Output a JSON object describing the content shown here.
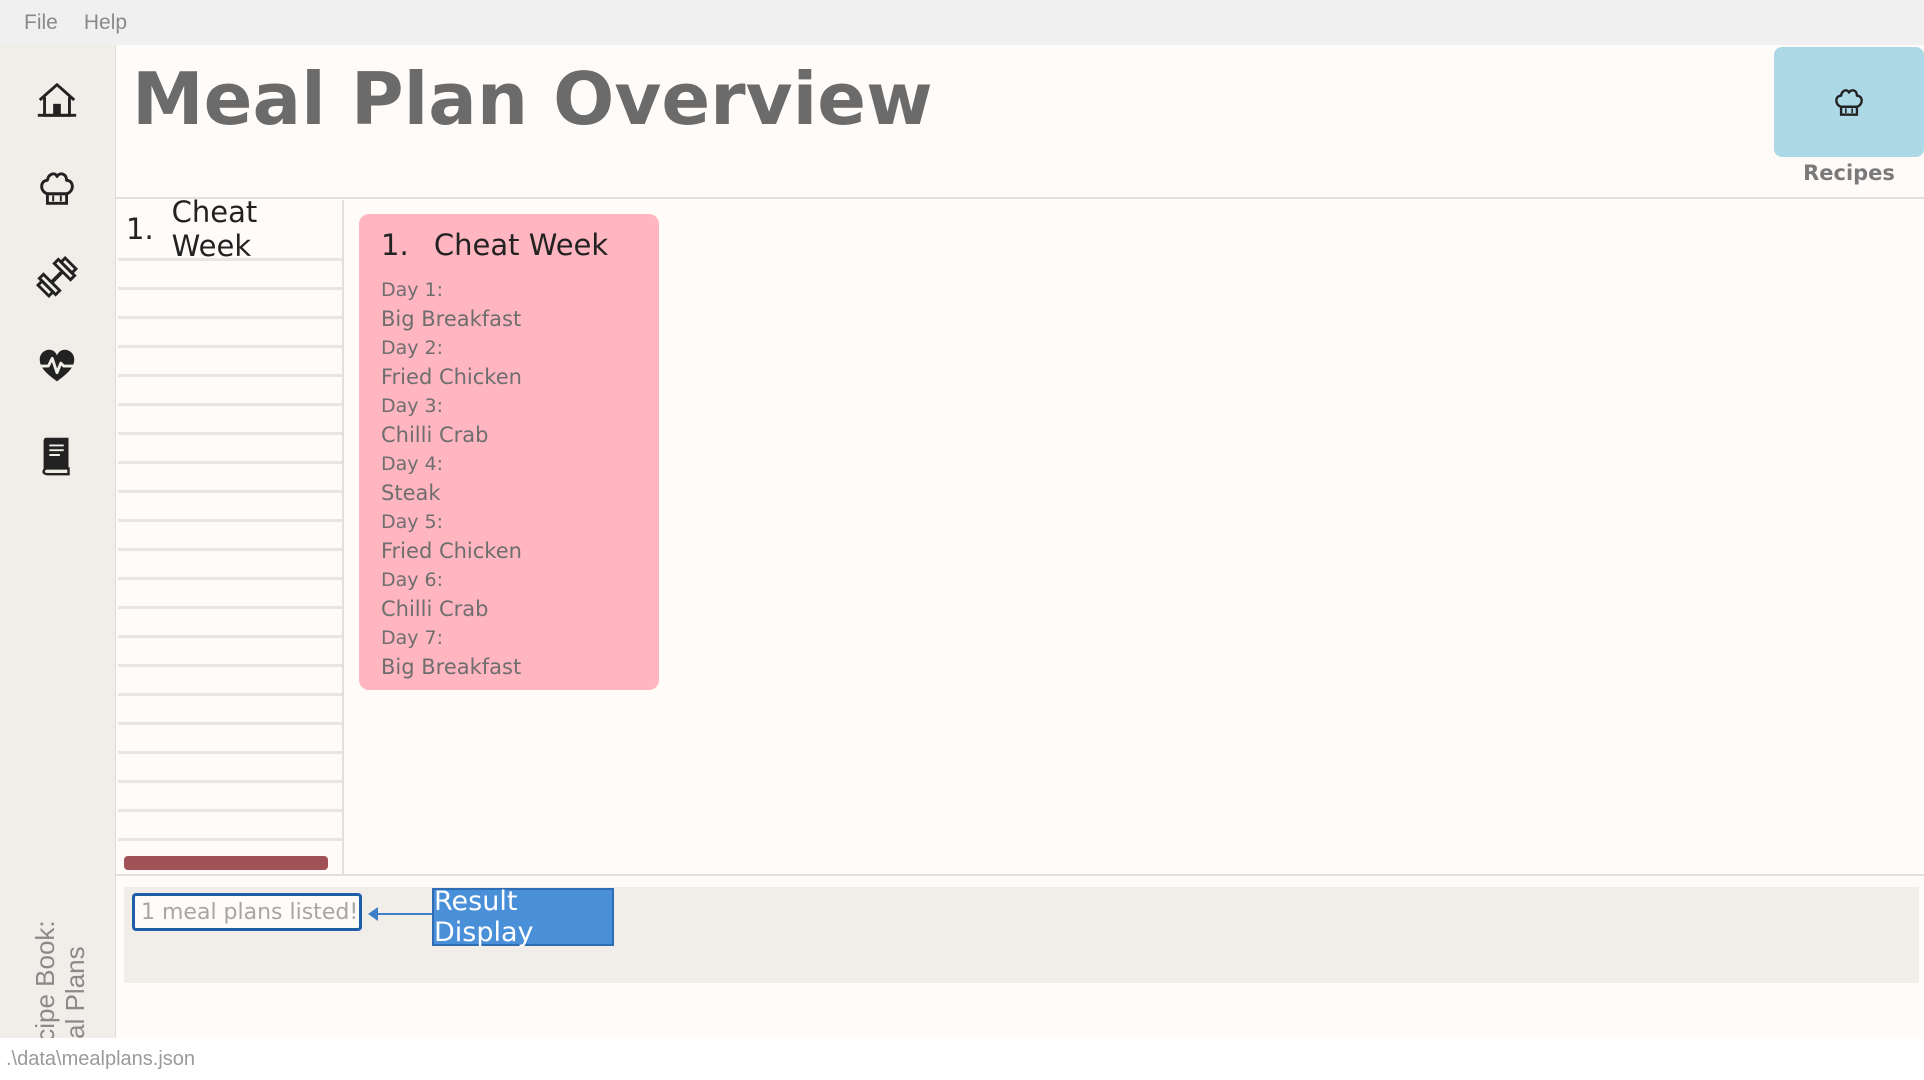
{
  "menu": {
    "file": "File",
    "help": "Help"
  },
  "sidebar": {
    "title_line1": "Recipe Book:",
    "title_line2": "Meal Plans",
    "items": [
      {
        "icon": "home-icon"
      },
      {
        "icon": "chef-hat-icon"
      },
      {
        "icon": "dumbbell-icon"
      },
      {
        "icon": "heartbeat-icon"
      },
      {
        "icon": "book-icon"
      }
    ]
  },
  "header": {
    "title": "Meal Plan Overview",
    "recipes_label": "Recipes",
    "recipes_icon": "chef-hat-icon",
    "tile_color": "#add8e6"
  },
  "list": {
    "items": [
      {
        "index": "1.",
        "name": "Cheat Week"
      }
    ]
  },
  "card": {
    "index": "1.",
    "name": "Cheat Week",
    "color": "#ffb6c1",
    "days": [
      {
        "day": "Day 1:",
        "meal": "Big Breakfast"
      },
      {
        "day": "Day 2:",
        "meal": "Fried Chicken"
      },
      {
        "day": "Day 3:",
        "meal": "Chilli Crab"
      },
      {
        "day": "Day 4:",
        "meal": "Steak"
      },
      {
        "day": "Day 5:",
        "meal": "Fried Chicken"
      },
      {
        "day": "Day 6:",
        "meal": "Chilli Crab"
      },
      {
        "day": "Day 7:",
        "meal": "Big Breakfast"
      }
    ]
  },
  "result": {
    "text": "1 meal plans listed!",
    "callout": "Result Display"
  },
  "status": {
    "path": ".\\data\\mealplans.json"
  },
  "colors": {
    "scrollbar": "#a05256",
    "callout": "#4a90d9"
  }
}
